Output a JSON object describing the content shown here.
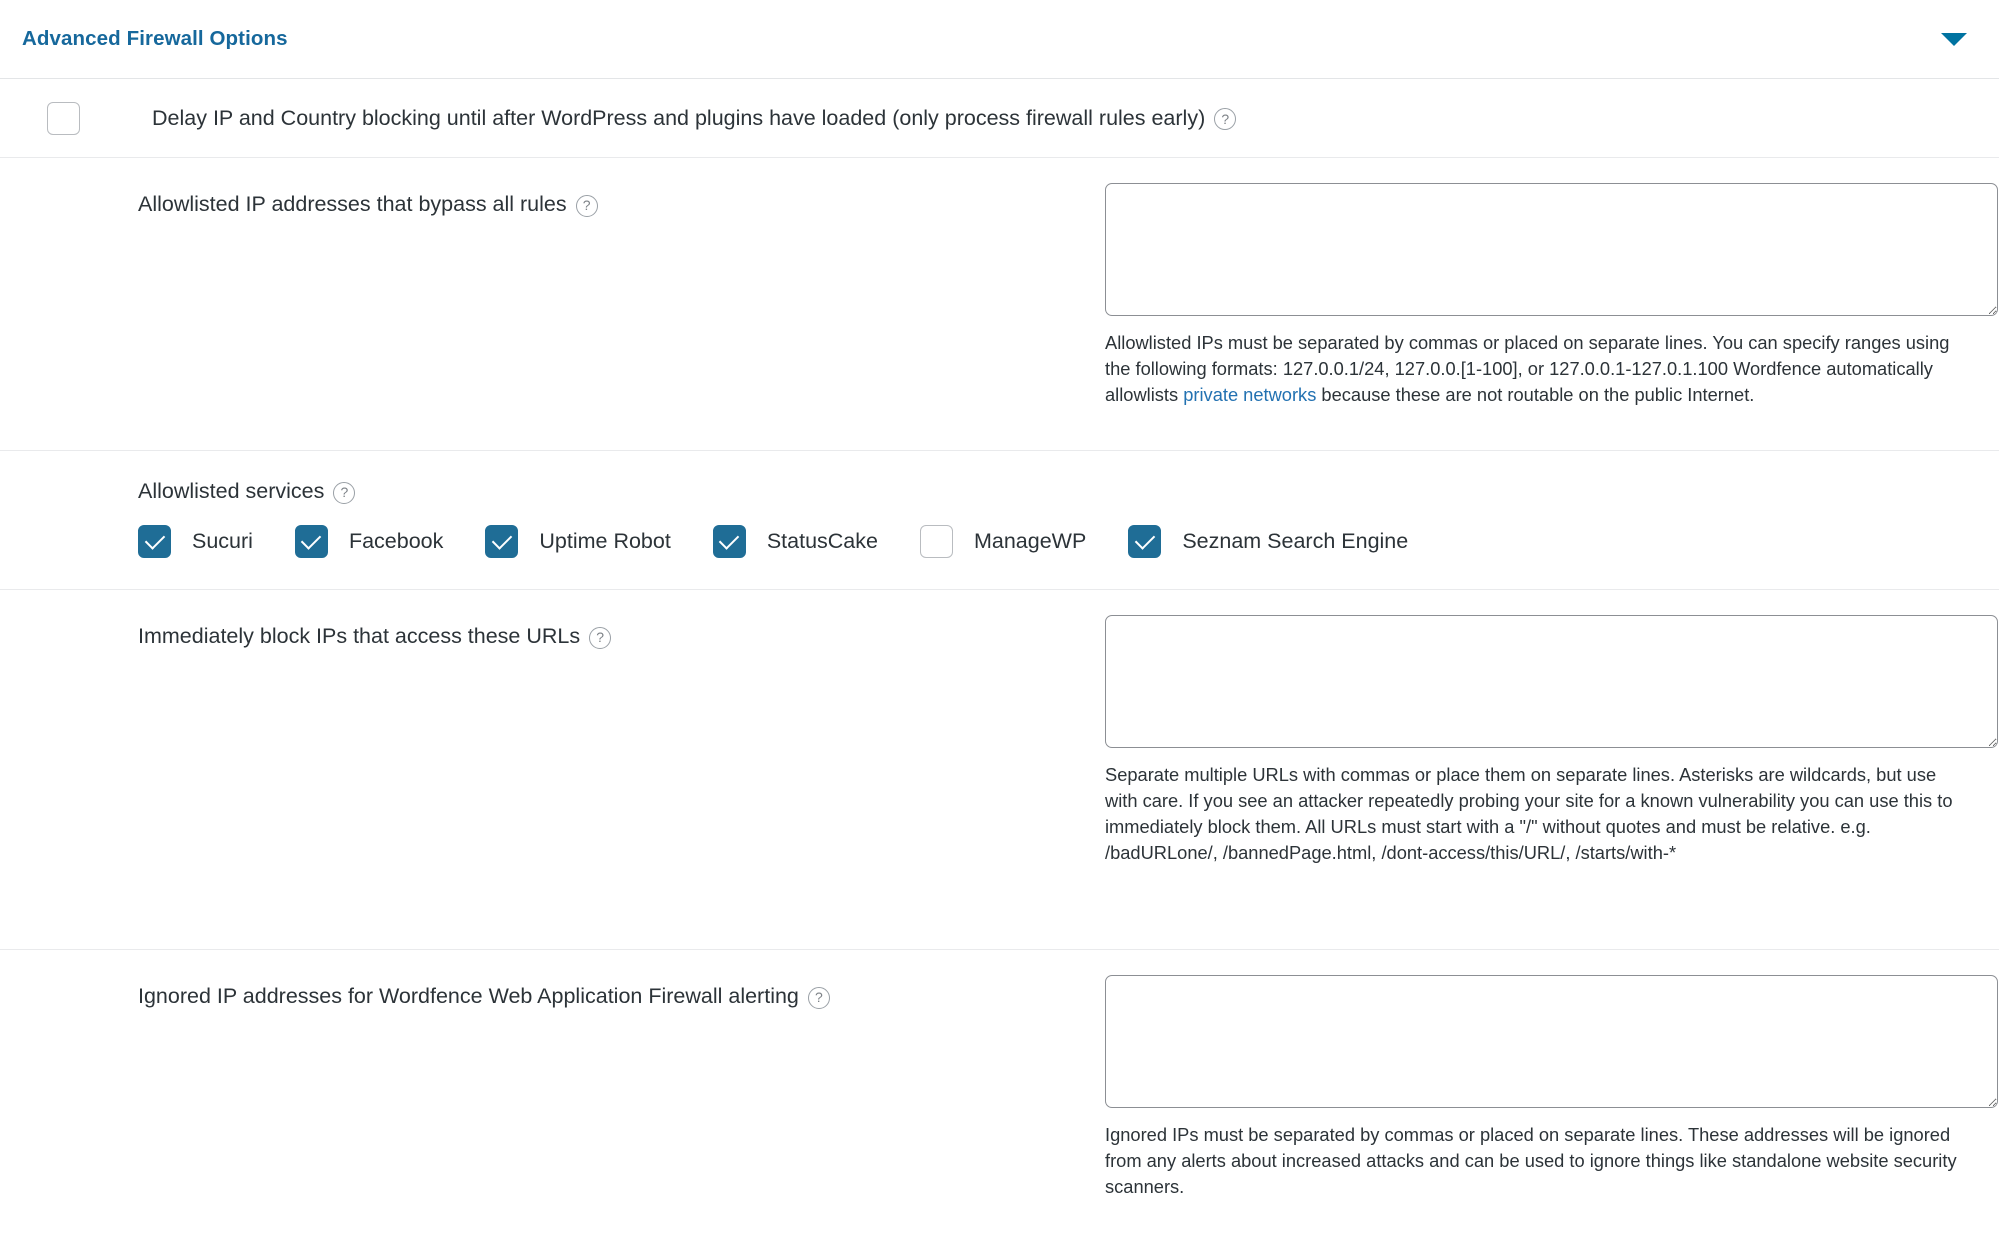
{
  "panel": {
    "title": "Advanced Firewall Options",
    "collapse_icon": "chevron-down-icon",
    "accent_color": "#16689c",
    "checkbox_checked_color": "#1f6d96",
    "link_color": "#2271b1"
  },
  "delay_option": {
    "label": "Delay IP and Country blocking until after WordPress and plugins have loaded (only process firewall rules early)",
    "checked": false,
    "help_icon": "help-circle-icon",
    "help_glyph": "?"
  },
  "allowlisted_ips": {
    "label": "Allowlisted IP addresses that bypass all rules",
    "help_glyph": "?",
    "value": "",
    "placeholder": "",
    "description_before_link": "Allowlisted IPs must be separated by commas or placed on separate lines. You can specify ranges using the following formats: 127.0.0.1/24, 127.0.0.[1-100], or 127.0.0.1-127.0.1.100 Wordfence automatically allowlists ",
    "description_link": "private networks",
    "description_after_link": " because these are not routable on the public Internet."
  },
  "allowlisted_services": {
    "label": "Allowlisted services",
    "help_glyph": "?",
    "items": [
      {
        "label": "Sucuri",
        "checked": true
      },
      {
        "label": "Facebook",
        "checked": true
      },
      {
        "label": "Uptime Robot",
        "checked": true
      },
      {
        "label": "StatusCake",
        "checked": true
      },
      {
        "label": "ManageWP",
        "checked": false
      },
      {
        "label": "Seznam Search Engine",
        "checked": true
      }
    ]
  },
  "block_urls": {
    "label": "Immediately block IPs that access these URLs",
    "help_glyph": "?",
    "value": "",
    "placeholder": "",
    "description": "Separate multiple URLs with commas or place them on separate lines. Asterisks are wildcards, but use with care. If you see an attacker repeatedly probing your site for a known vulnerability you can use this to immediately block them. All URLs must start with a \"/\" without quotes and must be relative. e.g. /badURLone/, /bannedPage.html, /dont-access/this/URL/, /starts/with-*"
  },
  "ignored_ips": {
    "label": "Ignored IP addresses for Wordfence Web Application Firewall alerting",
    "help_glyph": "?",
    "value": "",
    "placeholder": "",
    "description": "Ignored IPs must be separated by commas or placed on separate lines. These addresses will be ignored from any alerts about increased attacks and can be used to ignore things like standalone website security scanners."
  }
}
